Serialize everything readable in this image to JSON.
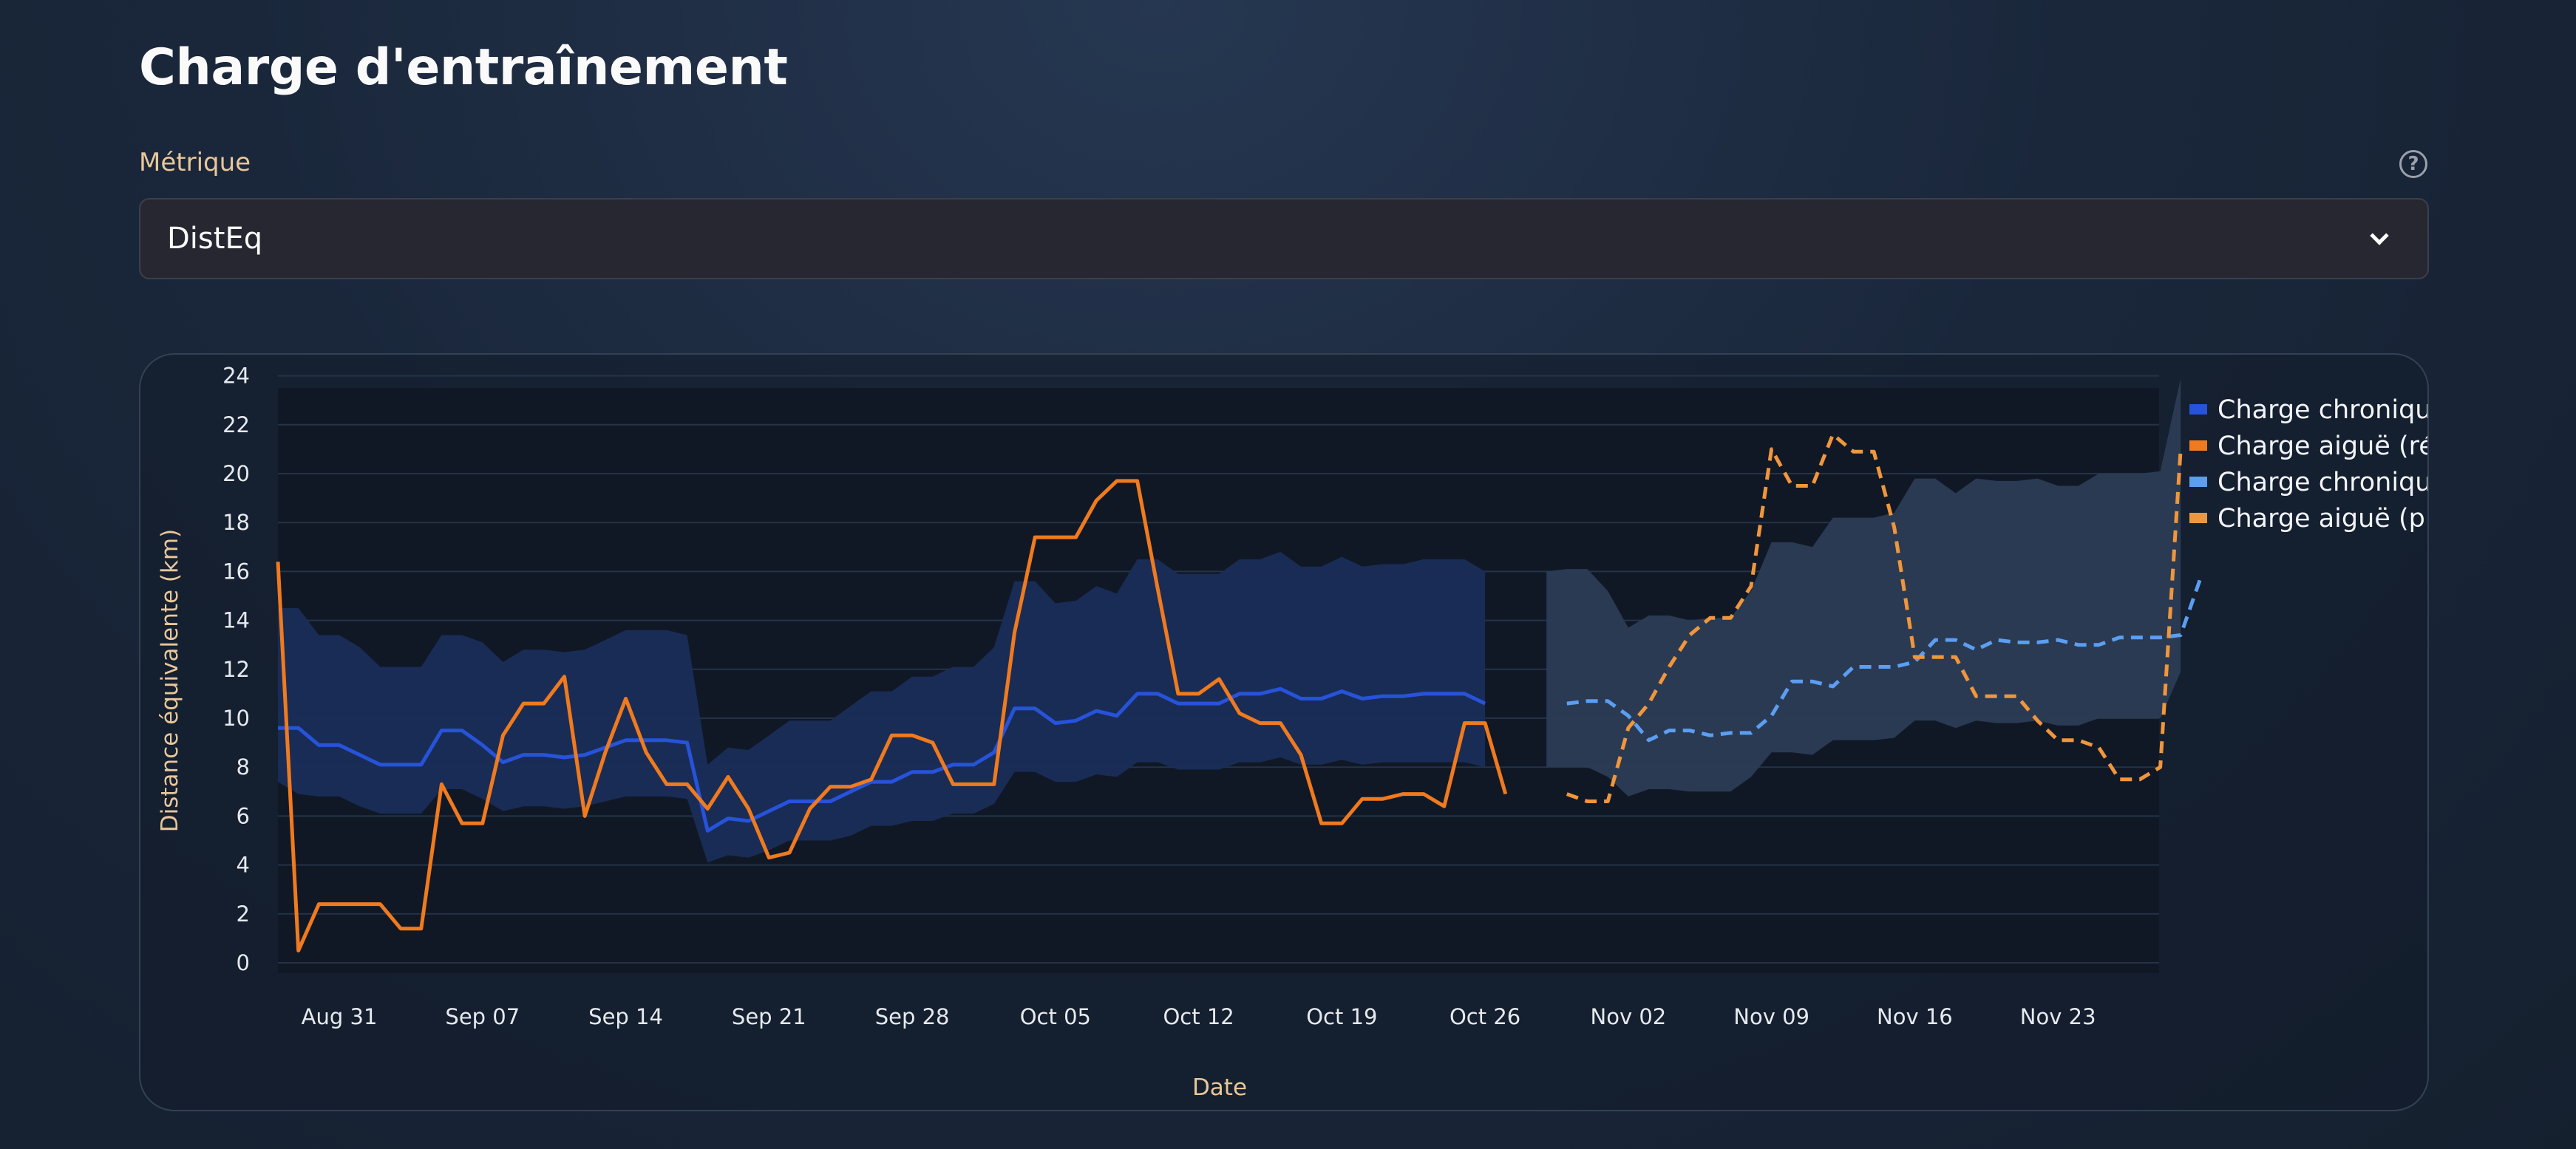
{
  "page": {
    "title": "Charge d'entraînement",
    "metric_label": "Métrique",
    "help_icon": "help-circle-icon",
    "select_value": "DistEq",
    "select_icon": "chevron-down-icon"
  },
  "colors": {
    "chronic_real": "#2653d9",
    "acute_real": "#f07a1e",
    "chronic_plan": "#5b9ef2",
    "acute_plan": "#f0963c",
    "band_real": "#1a2d58",
    "band_plan": "#2c3c55"
  },
  "chart_data": {
    "type": "line",
    "xlabel": "Date",
    "ylabel": "Distance équivalente (km)",
    "ylim": [
      0,
      24
    ],
    "yticks": [
      0,
      2,
      4,
      6,
      8,
      10,
      12,
      14,
      16,
      18,
      20,
      22,
      24
    ],
    "grid": true,
    "legend_position": "right",
    "start_date": "2025-08-28",
    "x_tick_labels": [
      "Aug 31",
      "Sep 07",
      "Sep 14",
      "Sep 21",
      "Sep 28",
      "Oct 05",
      "Oct 12",
      "Oct 19",
      "Oct 26",
      "Nov 02",
      "Nov 09",
      "Nov 16",
      "Nov 23"
    ],
    "series": [
      {
        "name": "Charge chronique …",
        "style": "solid",
        "offset": 0,
        "values": [
          9.6,
          9.6,
          8.9,
          8.9,
          8.5,
          8.1,
          8.1,
          8.1,
          9.5,
          9.5,
          8.9,
          8.2,
          8.5,
          8.5,
          8.4,
          8.5,
          8.8,
          9.1,
          9.1,
          9.1,
          9.0,
          5.4,
          5.9,
          5.8,
          6.2,
          6.6,
          6.6,
          6.6,
          7.0,
          7.4,
          7.4,
          7.8,
          7.8,
          8.1,
          8.1,
          8.6,
          10.4,
          10.4,
          9.8,
          9.9,
          10.3,
          10.1,
          11.0,
          11.0,
          10.6,
          10.6,
          10.6,
          11.0,
          11.0,
          11.2,
          10.8,
          10.8,
          11.1,
          10.8,
          10.9,
          10.9,
          11.0,
          11.0,
          11.0,
          10.6
        ]
      },
      {
        "name": "Charge aiguë (réal…",
        "style": "solid",
        "offset": 0,
        "values": [
          16.4,
          0.5,
          2.4,
          2.4,
          2.4,
          2.4,
          1.4,
          1.4,
          7.3,
          5.7,
          5.7,
          9.3,
          10.6,
          10.6,
          11.7,
          6.0,
          8.6,
          10.8,
          8.6,
          7.3,
          7.3,
          6.3,
          7.6,
          6.3,
          4.3,
          4.5,
          6.3,
          7.2,
          7.2,
          7.5,
          9.3,
          9.3,
          9.0,
          7.3,
          7.3,
          7.3,
          13.5,
          17.4,
          17.4,
          17.4,
          18.9,
          19.7,
          19.7,
          15.3,
          11.0,
          11.0,
          11.6,
          10.2,
          9.8,
          9.8,
          8.5,
          5.7,
          5.7,
          6.7,
          6.7,
          6.9,
          6.9,
          6.4,
          9.8,
          9.8,
          6.9
        ]
      },
      {
        "name": "Charge chronique …",
        "style": "dashed",
        "offset": 63,
        "values": [
          10.6,
          10.7,
          10.7,
          10.1,
          9.1,
          9.5,
          9.5,
          9.3,
          9.4,
          9.4,
          10.1,
          11.5,
          11.5,
          11.3,
          12.1,
          12.1,
          12.1,
          12.3,
          13.2,
          13.2,
          12.8,
          13.2,
          13.1,
          13.1,
          13.2,
          13.0,
          13.0,
          13.3,
          13.3,
          13.3,
          13.4,
          15.8
        ]
      },
      {
        "name": "Charge aiguë (pla…",
        "style": "dashed",
        "offset": 63,
        "values": [
          6.9,
          6.6,
          6.6,
          9.6,
          10.6,
          12.1,
          13.4,
          14.1,
          14.1,
          15.4,
          21.0,
          19.5,
          19.5,
          21.6,
          20.9,
          20.9,
          17.8,
          12.5,
          12.5,
          12.5,
          10.9,
          10.9,
          10.9,
          9.9,
          9.1,
          9.1,
          8.8,
          7.5,
          7.5,
          8.0,
          21.0
        ]
      }
    ],
    "bands": [
      {
        "style": "real",
        "offset": 0,
        "upper": [
          14.5,
          14.5,
          13.4,
          13.4,
          12.9,
          12.1,
          12.1,
          12.1,
          13.4,
          13.4,
          13.1,
          12.3,
          12.8,
          12.8,
          12.7,
          12.8,
          13.2,
          13.6,
          13.6,
          13.6,
          13.4,
          8.1,
          8.8,
          8.7,
          9.3,
          9.9,
          9.9,
          9.9,
          10.5,
          11.1,
          11.1,
          11.7,
          11.7,
          12.1,
          12.1,
          12.9,
          15.6,
          15.6,
          14.7,
          14.8,
          15.4,
          15.1,
          16.5,
          16.5,
          15.9,
          15.9,
          15.9,
          16.5,
          16.5,
          16.8,
          16.2,
          16.2,
          16.6,
          16.2,
          16.3,
          16.3,
          16.5,
          16.5,
          16.5,
          16.0
        ],
        "lower": [
          7.4,
          6.9,
          6.8,
          6.8,
          6.4,
          6.1,
          6.1,
          6.1,
          7.1,
          7.1,
          6.7,
          6.2,
          6.4,
          6.4,
          6.3,
          6.4,
          6.6,
          6.8,
          6.8,
          6.8,
          6.7,
          4.1,
          4.4,
          4.3,
          4.6,
          5.0,
          5.0,
          5.0,
          5.2,
          5.6,
          5.6,
          5.8,
          5.8,
          6.1,
          6.1,
          6.5,
          7.8,
          7.8,
          7.4,
          7.4,
          7.7,
          7.6,
          8.2,
          8.2,
          7.9,
          7.9,
          7.9,
          8.2,
          8.2,
          8.4,
          8.1,
          8.1,
          8.3,
          8.1,
          8.2,
          8.2,
          8.2,
          8.2,
          8.2,
          8.0
        ]
      },
      {
        "style": "plan",
        "offset": 62,
        "upper": [
          16.0,
          16.1,
          16.1,
          15.2,
          13.7,
          14.2,
          14.2,
          14.0,
          14.1,
          14.1,
          15.2,
          17.2,
          17.2,
          17.0,
          18.2,
          18.2,
          18.2,
          18.4,
          19.8,
          19.8,
          19.2,
          19.8,
          19.7,
          19.7,
          19.8,
          19.5,
          19.5,
          20.0,
          20.0,
          20.0,
          20.1,
          23.9
        ],
        "lower": [
          8.0,
          8.0,
          8.0,
          7.6,
          6.8,
          7.1,
          7.1,
          7.0,
          7.0,
          7.0,
          7.6,
          8.6,
          8.6,
          8.5,
          9.1,
          9.1,
          9.1,
          9.2,
          9.9,
          9.9,
          9.6,
          9.9,
          9.8,
          9.8,
          9.9,
          9.7,
          9.7,
          10.0,
          10.0,
          10.0,
          10.0,
          11.9
        ]
      }
    ]
  }
}
